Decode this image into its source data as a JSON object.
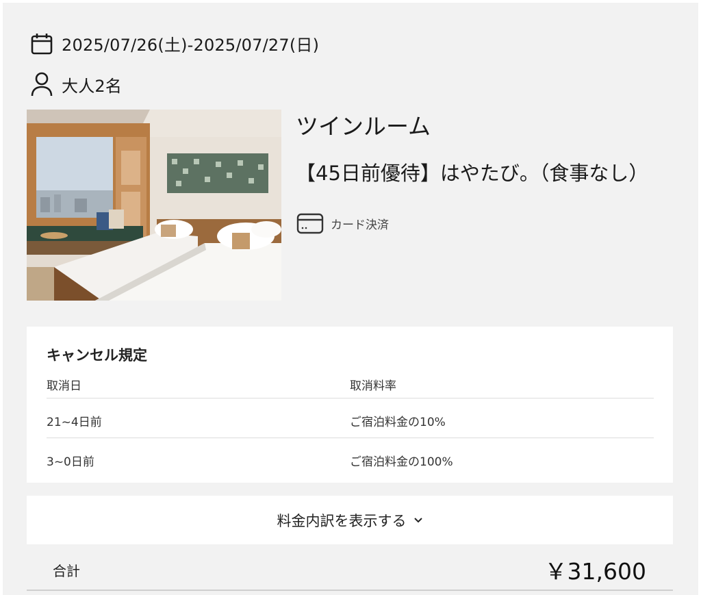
{
  "stay": {
    "dates": "2025/07/26(土)-2025/07/27(日)",
    "guests": "大人2名"
  },
  "room": {
    "name": "ツインルーム",
    "plan": "【45日前優待】はやたび。（食事なし）",
    "payment": "カード決済",
    "photo_icon": "twin-room-photo"
  },
  "cancellation": {
    "title": "キャンセル規定",
    "columns": [
      "取消日",
      "取消料率"
    ],
    "rows": [
      [
        "21~4日前",
        "ご宿泊料金の10%"
      ],
      [
        "3~0日前",
        "ご宿泊料金の100%"
      ]
    ]
  },
  "price": {
    "breakdown_label": "料金内訳を表示する",
    "total_label": "合計",
    "total_amount": "￥31,600"
  },
  "icons": {
    "date": "calendar-icon",
    "guests": "person-icon",
    "payment": "credit-card-icon",
    "expand": "chevron-down-icon"
  }
}
